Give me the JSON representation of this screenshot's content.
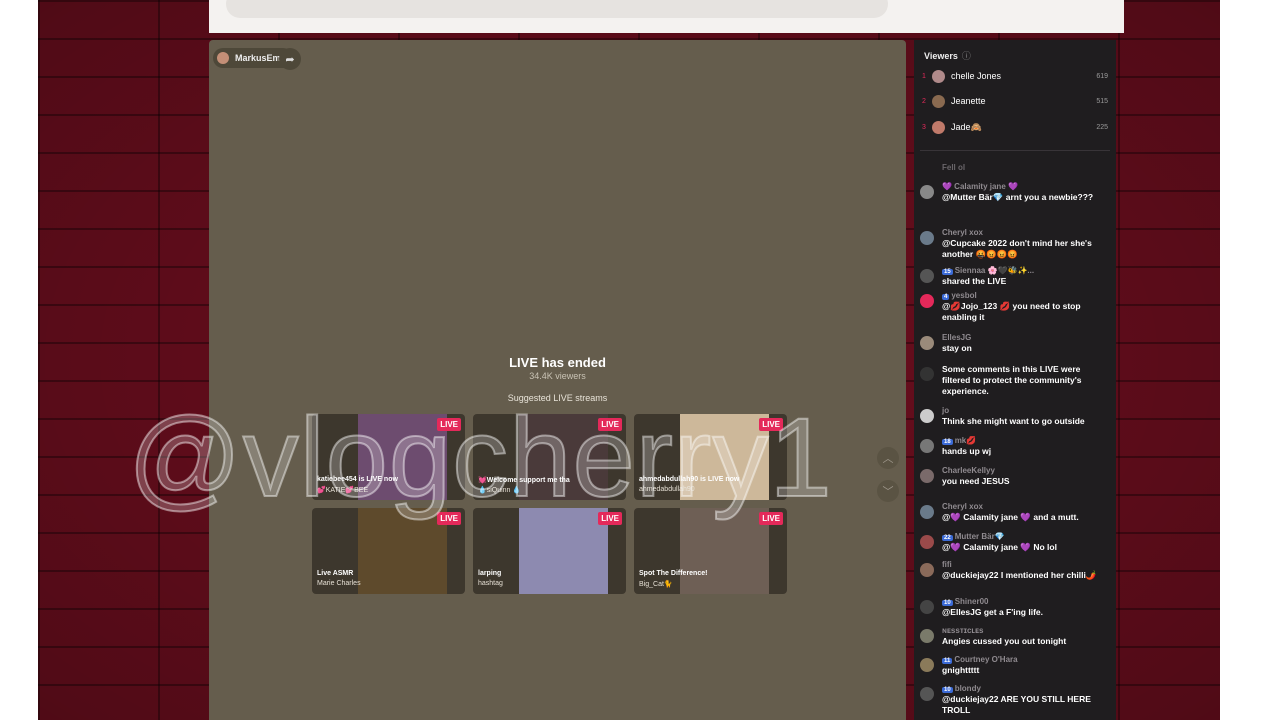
{
  "host": {
    "name": "MarkusEmz"
  },
  "stage": {
    "ended_title": "LIVE has ended",
    "viewers": "34.4K viewers",
    "suggested_label": "Suggested LIVE streams",
    "live_badge": "LIVE",
    "cards": [
      {
        "title": "katiebee454 is LIVE now",
        "user": "💕KATIE💕BEE",
        "color": "#6d4c6f"
      },
      {
        "title": "💓Welcome support me tha",
        "user": "💧siQuinn 💧",
        "color": "#4a3a3a"
      },
      {
        "title": "ahmedabdullah90 is LIVE now",
        "user": "ahmedabdullah90",
        "color": "#cdb89a"
      },
      {
        "title": "Live ASMR",
        "user": "Marie Charles",
        "color": "#5e4a2c"
      },
      {
        "title": "larping",
        "user": "hashtag",
        "color": "#8d8ab0"
      },
      {
        "title": "Spot The Difference!",
        "user": "Big_Cat🐈",
        "color": "#6e5f55"
      }
    ]
  },
  "watermark": "@vlogcherry1",
  "viewers_panel": {
    "title": "Viewers",
    "list": [
      {
        "rank": "1",
        "name": "chelle Jones",
        "score": "619",
        "color": "#b08a8a"
      },
      {
        "rank": "2",
        "name": "Jeanette",
        "score": "515",
        "color": "#8a6a50"
      },
      {
        "rank": "3",
        "name": "Jade🙈",
        "score": "225",
        "color": "#c07a6a"
      }
    ]
  },
  "chat": {
    "partial": "Fell ol",
    "messages": [
      {
        "badge": "",
        "user": "💜 Calamity jane 💜",
        "text": "@Mutter Bär💎 arnt you a newbie???",
        "color": "#888"
      },
      {
        "badge": "",
        "user": "Cheryl xox",
        "text": "@Cupcake 2022 don't mind her she's another 🤬😡😡😡",
        "color": "#6a7a8a"
      },
      {
        "badge": "15",
        "user": "Siennaa 🌸🖤🐝✨...",
        "text": "shared the LIVE",
        "color": "#555"
      },
      {
        "badge": "4",
        "user": "yesbol",
        "text": "@💋Jojo_123 💋 you need to stop enabling it",
        "color": "#e4295a"
      },
      {
        "badge": "",
        "user": "EllesJG",
        "text": "stay on",
        "color": "#9a8a7a"
      },
      {
        "badge": "",
        "user": "",
        "text": "Some comments in this LIVE were filtered to protect the community's experience.",
        "color": "#333"
      },
      {
        "badge": "",
        "user": "jo",
        "text": "Think she might want to go outside",
        "color": "#ccc"
      },
      {
        "badge": "18",
        "user": "mk💋",
        "text": "hands up wj",
        "color": "#777"
      },
      {
        "badge": "",
        "user": "CharleeKellyy",
        "text": "you need JESUS",
        "color": "#7a6a6a"
      },
      {
        "badge": "",
        "user": "Cheryl xox",
        "text": "@💜 Calamity jane 💜 and a mutt.",
        "color": "#6a7a8a"
      },
      {
        "badge": "22",
        "user": "Mutter Bär💎",
        "text": "@💜 Calamity jane 💜 No lol",
        "color": "#9a4a4a"
      },
      {
        "badge": "",
        "user": "fifi",
        "text": "@duckiejay22 I mentioned her chilli🌶️",
        "color": "#8a6a5a"
      },
      {
        "badge": "10",
        "user": "Shiner00",
        "text": "@EllesJG get a F'ing life.",
        "color": "#444"
      },
      {
        "badge": "",
        "user": "ɴᴇssᴛɪᴄʟᴇs",
        "text": "Angies cussed you out tonight",
        "color": "#7a7a6a"
      },
      {
        "badge": "11",
        "user": "Courtney O'Hara",
        "text": "gnighttttt",
        "color": "#8a7a5a"
      },
      {
        "badge": "10",
        "user": "blondy",
        "text": "@duckiejay22 ARE YOU STILL HERE TROLL",
        "color": "#555"
      }
    ]
  }
}
